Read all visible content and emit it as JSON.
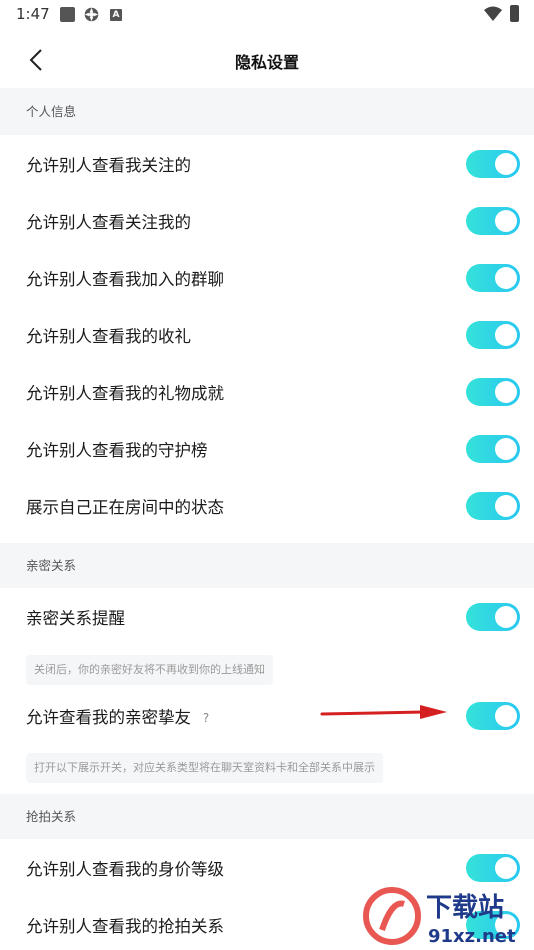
{
  "status": {
    "time": "1:47",
    "icons": [
      "notification-square-icon",
      "gear-icon",
      "a-icon",
      "wifi-icon",
      "battery-charging-icon"
    ],
    "a_glyph": "A"
  },
  "nav": {
    "back_icon": "chevron-left-icon",
    "title": "隐私设置"
  },
  "sections": {
    "personal": "个人信息",
    "intimate": "亲密关系",
    "grab": "抢拍关系"
  },
  "rows": {
    "r1": "允许别人查看我关注的",
    "r2": "允许别人查看关注我的",
    "r3": "允许别人查看我加入的群聊",
    "r4": "允许别人查看我的收礼",
    "r5": "允许别人查看我的礼物成就",
    "r6": "允许别人查看我的守护榜",
    "r7": "展示自己正在房间中的状态",
    "r8": "亲密关系提醒",
    "r9": "允许查看我的亲密挚友",
    "r10": "允许别人查看我的身价等级",
    "r11": "允许别人查看我的抢拍关系"
  },
  "hints": {
    "h1": "关闭后，你的亲密好友将不再收到你的上线通知",
    "h2": "打开以下展示开关，对应关系类型将在聊天室资料卡和全部关系中展示"
  },
  "help_glyph": "?",
  "toggles_on": true,
  "colors": {
    "toggle_start": "#35e2d9",
    "toggle_end": "#29c8f0",
    "arrow": "#d42020",
    "section_bg": "#f5f6f8"
  },
  "watermark": {
    "line1": "下载站",
    "line2": "91xz.net"
  }
}
